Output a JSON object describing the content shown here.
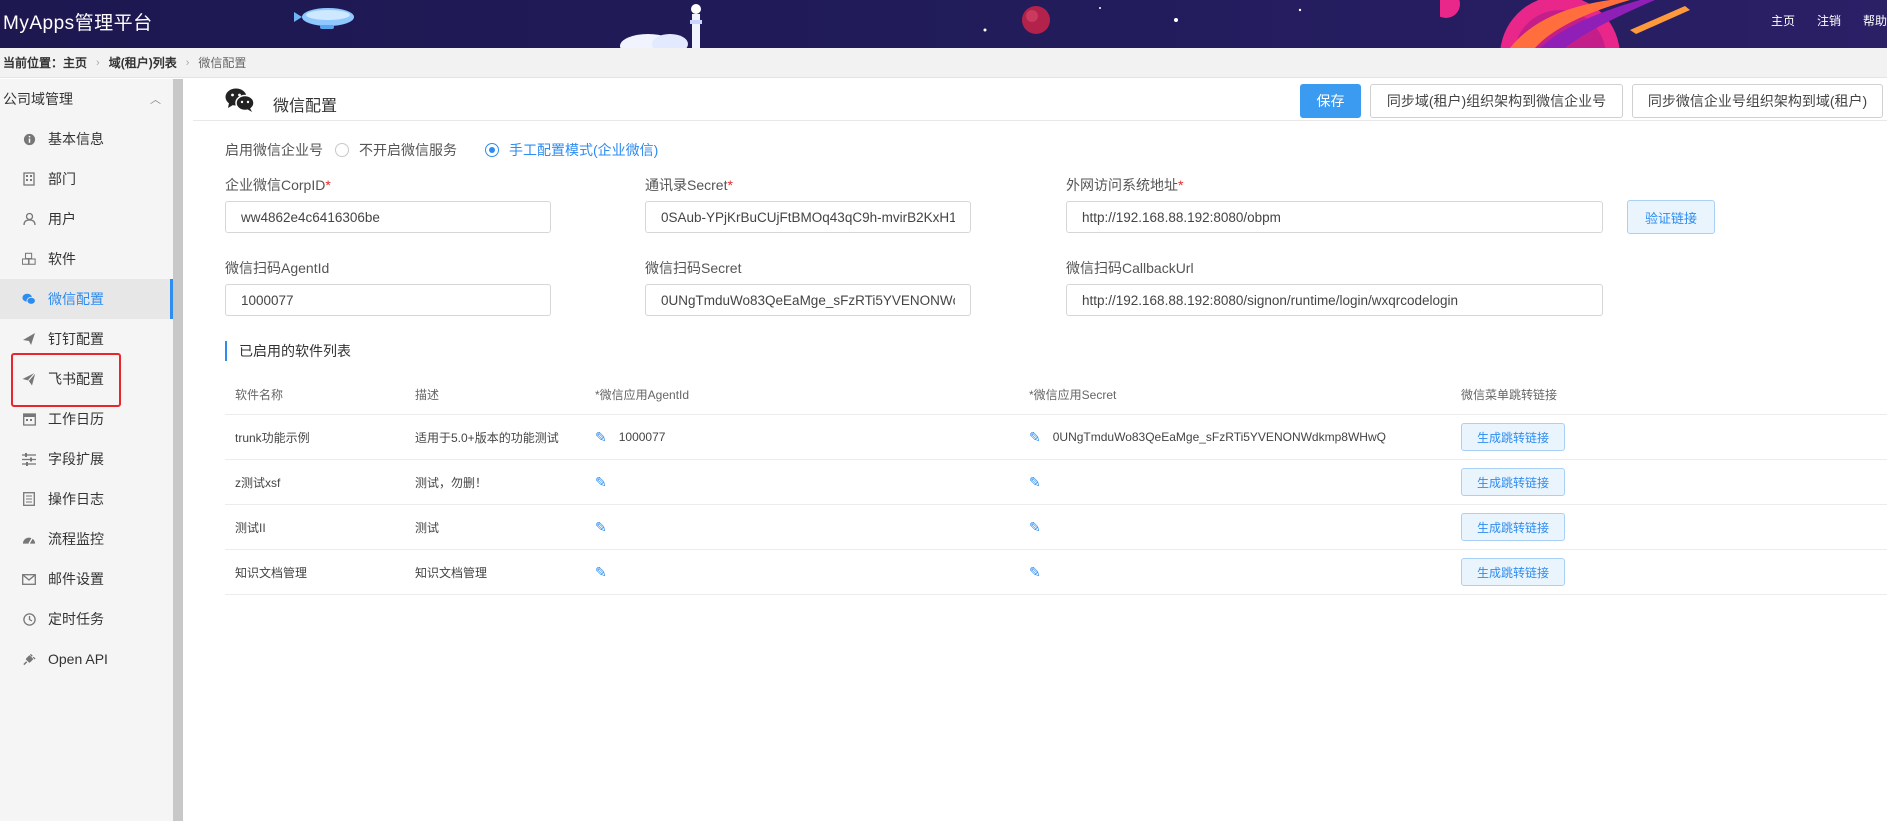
{
  "app": {
    "title": "MyApps管理平台"
  },
  "top_links": [
    "主页",
    "注销",
    "帮助"
  ],
  "breadcrumb": {
    "label": "当前位置：",
    "items": [
      "主页",
      "域(租户)列表",
      "微信配置"
    ]
  },
  "sidebar": {
    "group": "公司域管理",
    "items": [
      {
        "label": "基本信息",
        "icon": "info-icon"
      },
      {
        "label": "部门",
        "icon": "building-icon"
      },
      {
        "label": "用户",
        "icon": "user-icon"
      },
      {
        "label": "软件",
        "icon": "cubes-icon"
      },
      {
        "label": "微信配置",
        "icon": "wechat-icon",
        "active": true
      },
      {
        "label": "钉钉配置",
        "icon": "plane-icon"
      },
      {
        "label": "飞书配置",
        "icon": "paper-plane-icon"
      },
      {
        "label": "工作日历",
        "icon": "calendar-icon"
      },
      {
        "label": "字段扩展",
        "icon": "sliders-icon"
      },
      {
        "label": "操作日志",
        "icon": "log-icon"
      },
      {
        "label": "流程监控",
        "icon": "dashboard-icon"
      },
      {
        "label": "邮件设置",
        "icon": "envelope-icon"
      },
      {
        "label": "定时任务",
        "icon": "clock-icon"
      },
      {
        "label": "Open API",
        "icon": "plug-icon"
      }
    ]
  },
  "page": {
    "title": "微信配置",
    "buttons": {
      "save": "保存",
      "sync_to_wx": "同步域(租户)组织架构到微信企业号",
      "sync_from_wx": "同步微信企业号组织架构到域(租户)"
    }
  },
  "form": {
    "enable_label": "启用微信企业号",
    "options": [
      {
        "label": "不开启微信服务",
        "selected": false
      },
      {
        "label": "手工配置模式(企业微信)",
        "selected": true
      }
    ],
    "corp_id": {
      "label": "企业微信CorpID",
      "value": "ww4862e4c6416306be"
    },
    "contacts_secret": {
      "label": "通讯录Secret",
      "value": "0SAub-YPjKrBuCUjFtBMOq43qC9h-mvirB2KxH1"
    },
    "external_url": {
      "label": "外网访问系统地址",
      "value": "http://192.168.88.192:8080/obpm"
    },
    "verify_button": "验证链接",
    "agent_id": {
      "label": "微信扫码AgentId",
      "value": "1000077"
    },
    "scan_secret": {
      "label": "微信扫码Secret",
      "value": "0UNgTmduWo83QeEaMge_sFzRTi5YVENONWc"
    },
    "callback_url": {
      "label": "微信扫码CallbackUrl",
      "value": "http://192.168.88.192:8080/signon/runtime/login/wxqrcodelogin"
    },
    "required_mark": "*"
  },
  "software_table": {
    "title": "已启用的软件列表",
    "columns": [
      "软件名称",
      "描述",
      "*微信应用AgentId",
      "*微信应用Secret",
      "微信菜单跳转链接"
    ],
    "rows": [
      {
        "name": "trunk功能示例",
        "desc": "适用于5.0+版本的功能测试",
        "agent_id": "1000077",
        "secret": "0UNgTmduWo83QeEaMge_sFzRTi5YVENONWdkmp8WHwQ",
        "action": "生成跳转链接"
      },
      {
        "name": "z测试xsf",
        "desc": "测试，勿删！",
        "agent_id": "",
        "secret": "",
        "action": "生成跳转链接"
      },
      {
        "name": "测试II",
        "desc": "测试",
        "agent_id": "",
        "secret": "",
        "action": "生成跳转链接"
      },
      {
        "name": "知识文档管理",
        "desc": "知识文档管理",
        "agent_id": "",
        "secret": "",
        "action": "生成跳转链接"
      }
    ]
  },
  "colors": {
    "accent": "#2d8cf0",
    "header_bg": "#1d1850",
    "highlight": "#e8262c"
  }
}
